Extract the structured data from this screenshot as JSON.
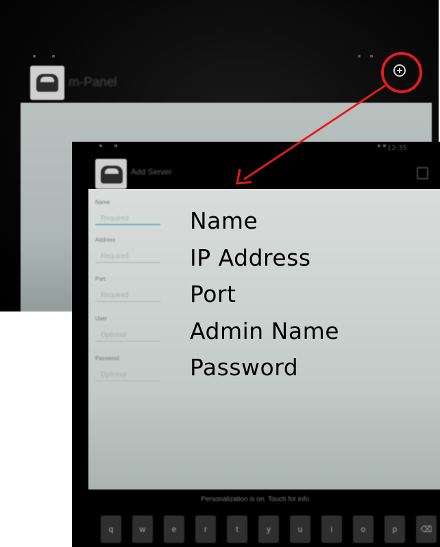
{
  "back_screen": {
    "title": "m-Panel",
    "add_button_icon": "plus-circle-icon",
    "highlight_color": "#e51c1c"
  },
  "add_server_screen": {
    "title": "Add Server",
    "status_time": "12:35",
    "save_icon": "save-icon",
    "fields": [
      {
        "label": "Name",
        "placeholder": "Required"
      },
      {
        "label": "Address",
        "placeholder": "Required"
      },
      {
        "label": "Port",
        "placeholder": "Required"
      },
      {
        "label": "User",
        "placeholder": "Optional"
      },
      {
        "label": "Password",
        "placeholder": "Optional"
      }
    ],
    "ime_status": "Personalization is on. Touch for info.",
    "keyboard_keys": [
      "q",
      "w",
      "e",
      "r",
      "t",
      "y",
      "u",
      "i",
      "o",
      "p"
    ]
  },
  "annotations": [
    "Name",
    "IP Address",
    "Port",
    "Admin Name",
    "Password"
  ],
  "colors": {
    "arrow": "#e51c1c",
    "accent_underline": "#6fa9b6"
  }
}
